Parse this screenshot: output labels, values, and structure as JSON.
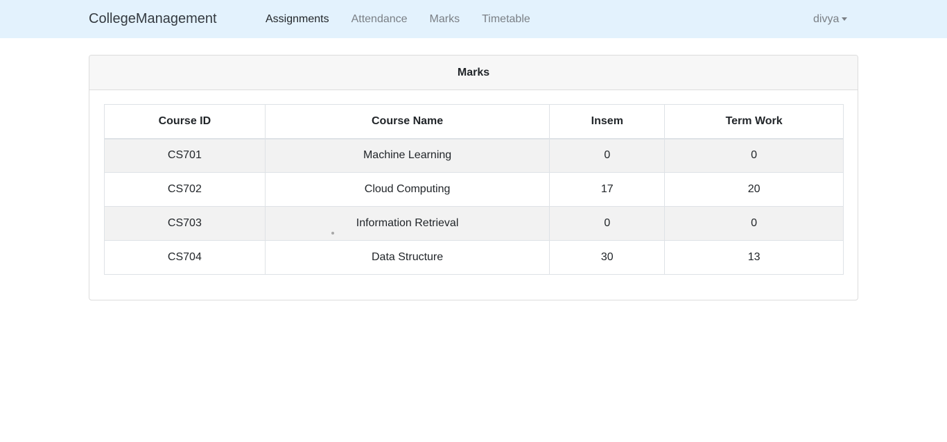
{
  "navbar": {
    "brand": "CollegeManagement",
    "links": [
      {
        "label": "Assignments",
        "active": true
      },
      {
        "label": "Attendance",
        "active": false
      },
      {
        "label": "Marks",
        "active": false
      },
      {
        "label": "Timetable",
        "active": false
      }
    ],
    "user": "divya",
    "user_icon": "caret-down-icon"
  },
  "card": {
    "title": "Marks"
  },
  "table": {
    "headers": [
      "Course ID",
      "Course Name",
      "Insem",
      "Term Work"
    ],
    "rows": [
      [
        "CS701",
        "Machine Learning",
        "0",
        "0"
      ],
      [
        "CS702",
        "Cloud Computing",
        "17",
        "20"
      ],
      [
        "CS703",
        "Information Retrieval",
        "0",
        "0"
      ],
      [
        "CS704",
        "Data Structure",
        "30",
        "13"
      ]
    ]
  },
  "colors": {
    "navbar_bg": "#e3f2fd",
    "card_header_bg": "#f7f7f7",
    "striped_row_bg": "#f2f2f2",
    "border": "#dee2e6",
    "muted_link": "#7a7f85"
  }
}
